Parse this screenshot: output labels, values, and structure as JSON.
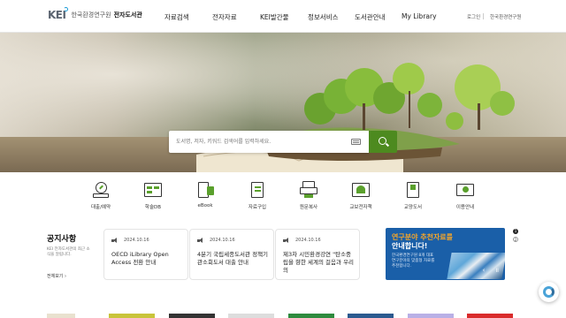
{
  "header": {
    "logo_mark": "KEI",
    "org_name": "한국환경연구원",
    "library_name": "전자도서관",
    "nav": [
      "자료검색",
      "전자자료",
      "KEI발간물",
      "정보서비스",
      "도서관안내",
      "My Library"
    ],
    "util": {
      "login": "로그인",
      "org_link": "한국환경연구원"
    }
  },
  "search": {
    "placeholder": "도서명, 저자, 키워드 검색어를 입력하세요."
  },
  "quick_menu": [
    {
      "label": "대출/예약",
      "icon": "loan-icon"
    },
    {
      "label": "학술DB",
      "icon": "database-icon"
    },
    {
      "label": "eBook",
      "icon": "ebook-icon"
    },
    {
      "label": "자료구입",
      "icon": "purchase-icon"
    },
    {
      "label": "원문복사",
      "icon": "copy-icon"
    },
    {
      "label": "교보전자책",
      "icon": "kyobo-ebook-icon"
    },
    {
      "label": "교양도서",
      "icon": "culture-book-icon"
    },
    {
      "label": "이용안내",
      "icon": "guide-icon"
    }
  ],
  "notice": {
    "title": "공지사항",
    "desc": "KEI 전자도서관의 최근 소식을 알립니다.",
    "more": "전체보기",
    "items": [
      {
        "date": "2024.10.16",
        "title": "OECD iLibrary Open Access 전환 안내"
      },
      {
        "date": "2024.10.16",
        "title": "4분기 국립세종도서관 정책기 관소회도서 대출 안내"
      },
      {
        "date": "2024.10.16",
        "title": "제3차 시민환경강연 \"탄소중립을 향한 세계의 걸음과 우리의"
      }
    ]
  },
  "banner": {
    "line1": "연구분야 추천자료를",
    "line2": "안내합니다!",
    "desc": "한국환경연구원 8개 대표 연구분야의 맞춤형 자료를 추천합니다.",
    "pages": [
      "1",
      "2"
    ],
    "prev": "‹",
    "pause": "॥",
    "next": "›"
  },
  "colors": {
    "accent_green": "#4d8a1f",
    "banner_blue": "#1a5fa8",
    "banner_orange": "#f5a62a"
  }
}
